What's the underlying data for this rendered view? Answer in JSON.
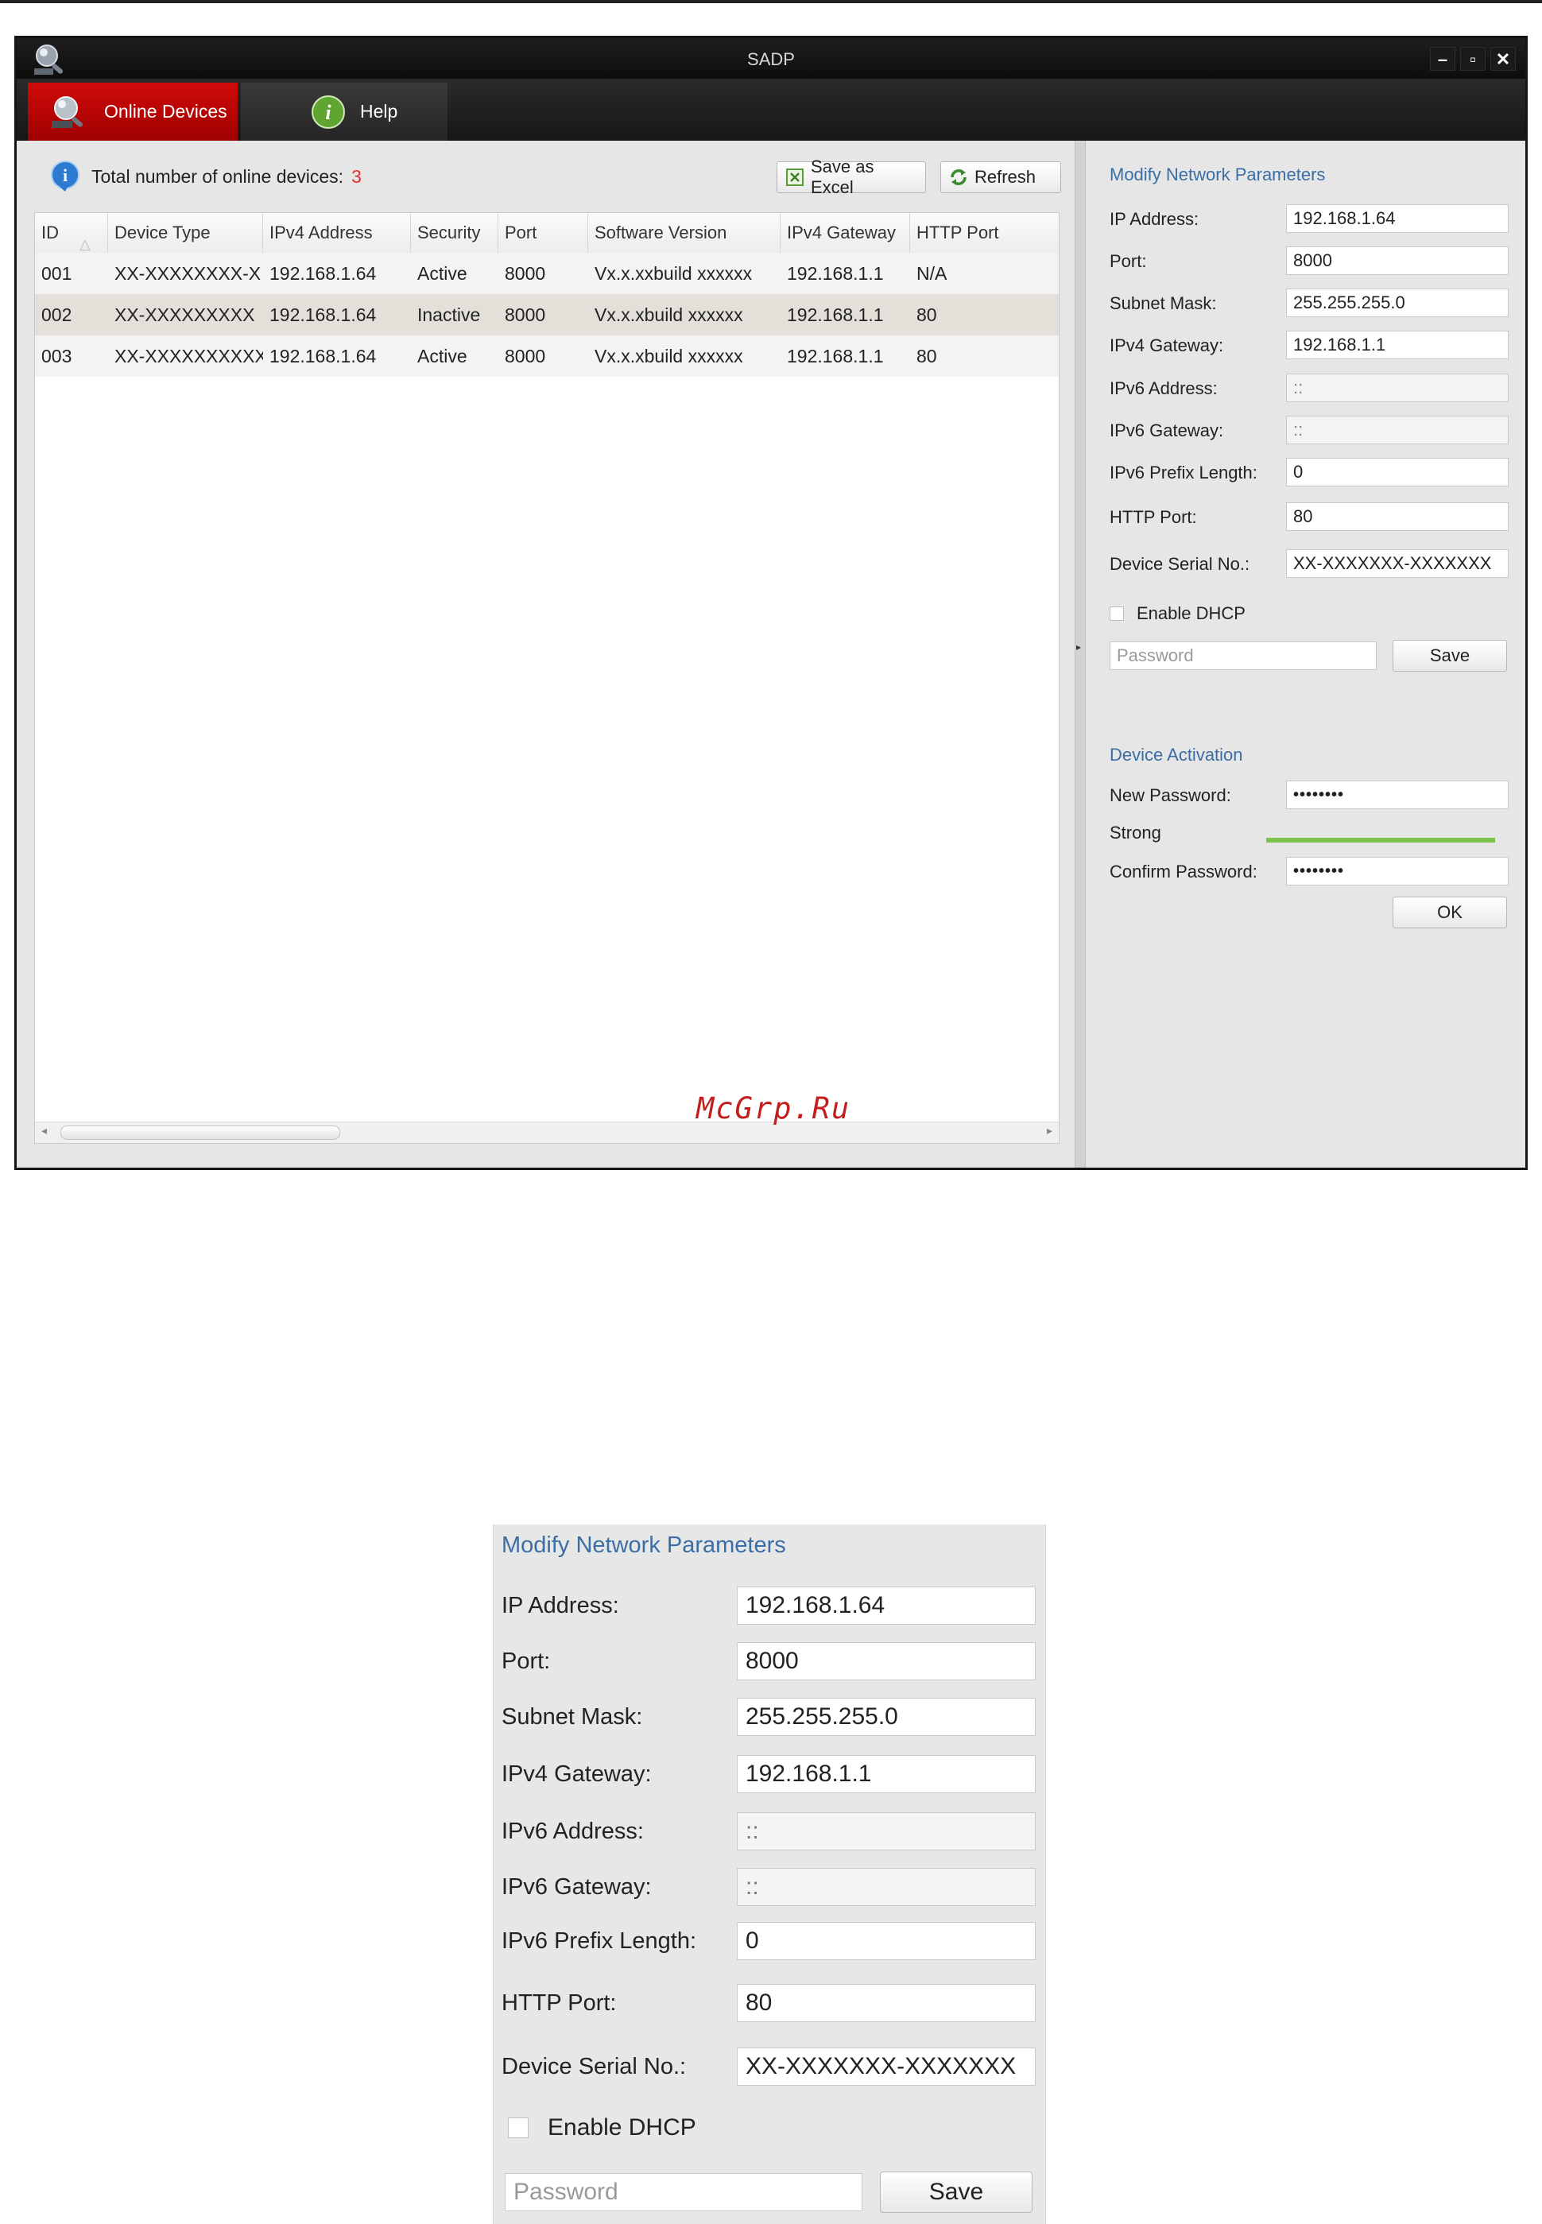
{
  "window": {
    "title": "SADP",
    "minimize": "–",
    "maximize": "▫",
    "close": "✕"
  },
  "tabs": [
    {
      "label": "Online Devices",
      "active": true
    },
    {
      "label": "Help",
      "active": false
    }
  ],
  "list": {
    "total_label": "Total number of online devices:",
    "total_count": "3",
    "save_excel_label": "Save as Excel",
    "refresh_label": "Refresh",
    "columns": [
      "ID",
      "Device Type",
      "IPv4 Address",
      "Security",
      "Port",
      "Software Version",
      "IPv4 Gateway",
      "HTTP Port"
    ],
    "rows": [
      {
        "id": "001",
        "device_type": "XX-XXXXXXXX-X",
        "ipv4": "192.168.1.64",
        "security": "Active",
        "port": "8000",
        "software": "Vx.x.xxbuild xxxxxx",
        "gateway": "192.168.1.1",
        "http_port": "N/A"
      },
      {
        "id": "002",
        "device_type": "XX-XXXXXXXXX",
        "ipv4": "192.168.1.64",
        "security": "Inactive",
        "port": "8000",
        "software": "Vx.x.xbuild xxxxxx",
        "gateway": "192.168.1.1",
        "http_port": "80"
      },
      {
        "id": "003",
        "device_type": "XX-XXXXXXXXXX",
        "ipv4": "192.168.1.64",
        "security": "Active",
        "port": "8000",
        "software": "Vx.x.xbuild xxxxxx",
        "gateway": "192.168.1.1",
        "http_port": "80"
      }
    ]
  },
  "watermark": "McGrp.Ru",
  "modify": {
    "title": "Modify Network Parameters",
    "fields": [
      {
        "label": "IP Address:",
        "value": "192.168.1.64",
        "disabled": false
      },
      {
        "label": "Port:",
        "value": "8000",
        "disabled": false
      },
      {
        "label": "Subnet Mask:",
        "value": "255.255.255.0",
        "disabled": false
      },
      {
        "label": "IPv4 Gateway:",
        "value": "192.168.1.1",
        "disabled": false
      },
      {
        "label": "IPv6 Address:",
        "value": "::",
        "disabled": true
      },
      {
        "label": "IPv6 Gateway:",
        "value": "::",
        "disabled": true
      },
      {
        "label": "IPv6 Prefix Length:",
        "value": "0",
        "disabled": false
      },
      {
        "label": "HTTP Port:",
        "value": "80",
        "disabled": false
      },
      {
        "label": "Device Serial No.:",
        "value": "XX-XXXXXXX-XXXXXXX",
        "disabled": false
      }
    ],
    "enable_dhcp_label": "Enable DHCP",
    "password_placeholder": "Password",
    "save_label": "Save"
  },
  "activation": {
    "title": "Device Activation",
    "new_password_label": "New Password:",
    "new_password_value": "••••••••",
    "strength_label": "Strong",
    "confirm_password_label": "Confirm Password:",
    "confirm_password_value": "••••••••",
    "ok_label": "OK"
  },
  "colors": {
    "accent_red": "#c00000",
    "link_blue": "#3a6ea5",
    "strength_green": "#7cc24c"
  }
}
